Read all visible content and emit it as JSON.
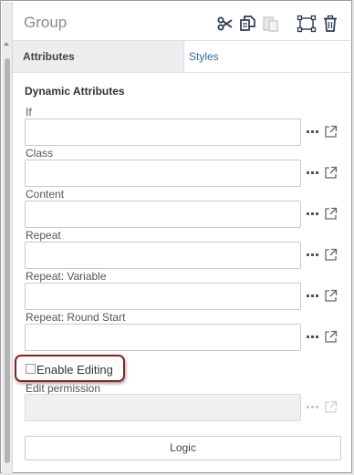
{
  "header": {
    "title": "Group",
    "icons": [
      "scissors-icon",
      "copy-icon",
      "paste-icon",
      "select-group-icon",
      "trash-icon"
    ]
  },
  "tabs": [
    {
      "label": "Attributes",
      "active": true
    },
    {
      "label": "Styles",
      "active": false
    }
  ],
  "section": {
    "title": "Dynamic Attributes"
  },
  "fields": [
    {
      "label": "If",
      "value": ""
    },
    {
      "label": "Class",
      "value": ""
    },
    {
      "label": "Content",
      "value": ""
    },
    {
      "label": "Repeat",
      "value": ""
    },
    {
      "label": "Repeat: Variable",
      "value": ""
    },
    {
      "label": "Repeat: Round Start",
      "value": ""
    }
  ],
  "enable_editing": {
    "label": "Enable Editing",
    "checked": false
  },
  "edit_permission": {
    "label": "Edit permission",
    "value": "",
    "disabled": true
  },
  "logic_button": {
    "label": "Logic"
  },
  "colors": {
    "link": "#2d6ca8",
    "highlight": "#8b2020",
    "active_tab": "#ededed"
  }
}
